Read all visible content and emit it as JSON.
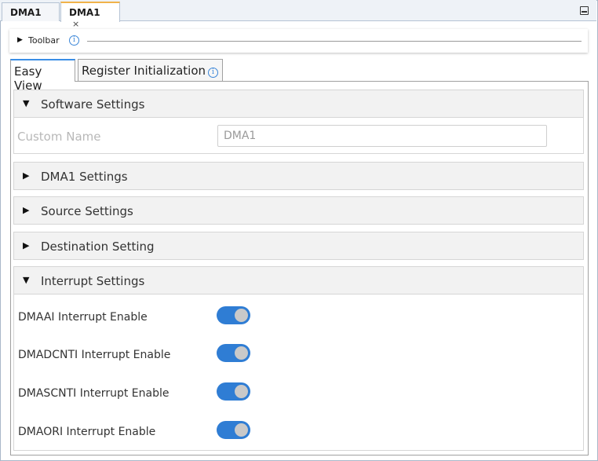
{
  "doc_tabs": [
    {
      "label": "DMA1"
    },
    {
      "label": "DMA1",
      "close": "×"
    }
  ],
  "toolbar": {
    "label": "Toolbar",
    "info": "i"
  },
  "inner_tabs": [
    {
      "label": "Easy View"
    },
    {
      "label": "Register Initialization",
      "info": "i"
    }
  ],
  "sections": {
    "software": {
      "title": "Software Settings",
      "expanded": true,
      "custom_name_label": "Custom Name",
      "custom_name_value": "DMA1"
    },
    "dma1": {
      "title": "DMA1 Settings",
      "expanded": false
    },
    "source": {
      "title": "Source Settings",
      "expanded": false
    },
    "destination": {
      "title": "Destination Setting",
      "expanded": false
    },
    "interrupt": {
      "title": "Interrupt Settings",
      "expanded": true,
      "rows": [
        {
          "label": "DMAAI Interrupt Enable",
          "enabled": true
        },
        {
          "label": "DMADCNTI Interrupt Enable",
          "enabled": true
        },
        {
          "label": "DMASCNTI Interrupt Enable",
          "enabled": true
        },
        {
          "label": "DMAORI Interrupt Enable",
          "enabled": true
        }
      ]
    }
  },
  "glyphs": {
    "expanded": "▼",
    "collapsed": "▶"
  },
  "colors": {
    "accent": "#2f7dd4",
    "active_tab_top": "#f0b24a"
  }
}
